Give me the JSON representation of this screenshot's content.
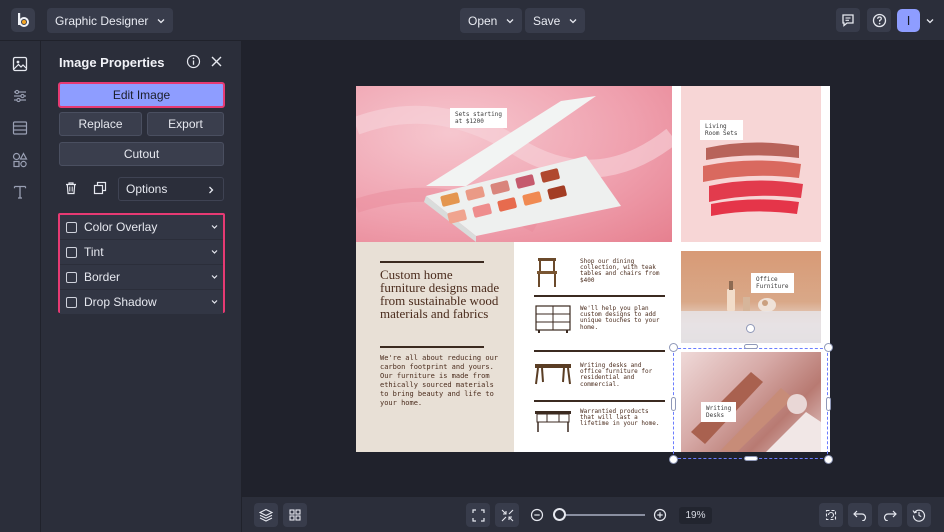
{
  "topbar": {
    "workspace_label": "Graphic Designer",
    "open_label": "Open",
    "save_label": "Save",
    "avatar_initial": "I"
  },
  "rail": {
    "icons": [
      "image-icon",
      "sliders-icon",
      "layout-icon",
      "shapes-icon",
      "text-icon"
    ]
  },
  "panel": {
    "title": "Image Properties",
    "edit_image_label": "Edit Image",
    "replace_label": "Replace",
    "export_label": "Export",
    "cutout_label": "Cutout",
    "options_label": "Options",
    "effects": [
      {
        "label": "Color Overlay",
        "checked": false
      },
      {
        "label": "Tint",
        "checked": false
      },
      {
        "label": "Border",
        "checked": false
      },
      {
        "label": "Drop Shadow",
        "checked": false
      }
    ]
  },
  "design": {
    "tag_sets": "Sets starting\nat $1200",
    "tag_living": "Living\nRoom Sets",
    "tag_office": "Office\nFurniture",
    "tag_desks": "Writing\nDesks",
    "headline": "Custom home furniture designs made from sustainable wood materials and fabrics",
    "body": "We're all about reducing our carbon footprint and yours. Our furniture is made from ethically sourced materials to bring beauty and life to your home.",
    "list": [
      "Shop our dining collection, with teak tables and chairs from $400",
      "We'll help you plan custom designs to add unique touches to your home.",
      "Writing desks and office furniture for residential and commercial.",
      "Warrantied products that will last a lifetime in your home."
    ]
  },
  "bottombar": {
    "zoom_value": "19%",
    "zoom_level": 0.19
  },
  "colors": {
    "accent": "#8e9dff",
    "highlight_border": "#e63a73",
    "panel_bg": "#2b2e3a",
    "canvas_bg": "#20222c"
  }
}
